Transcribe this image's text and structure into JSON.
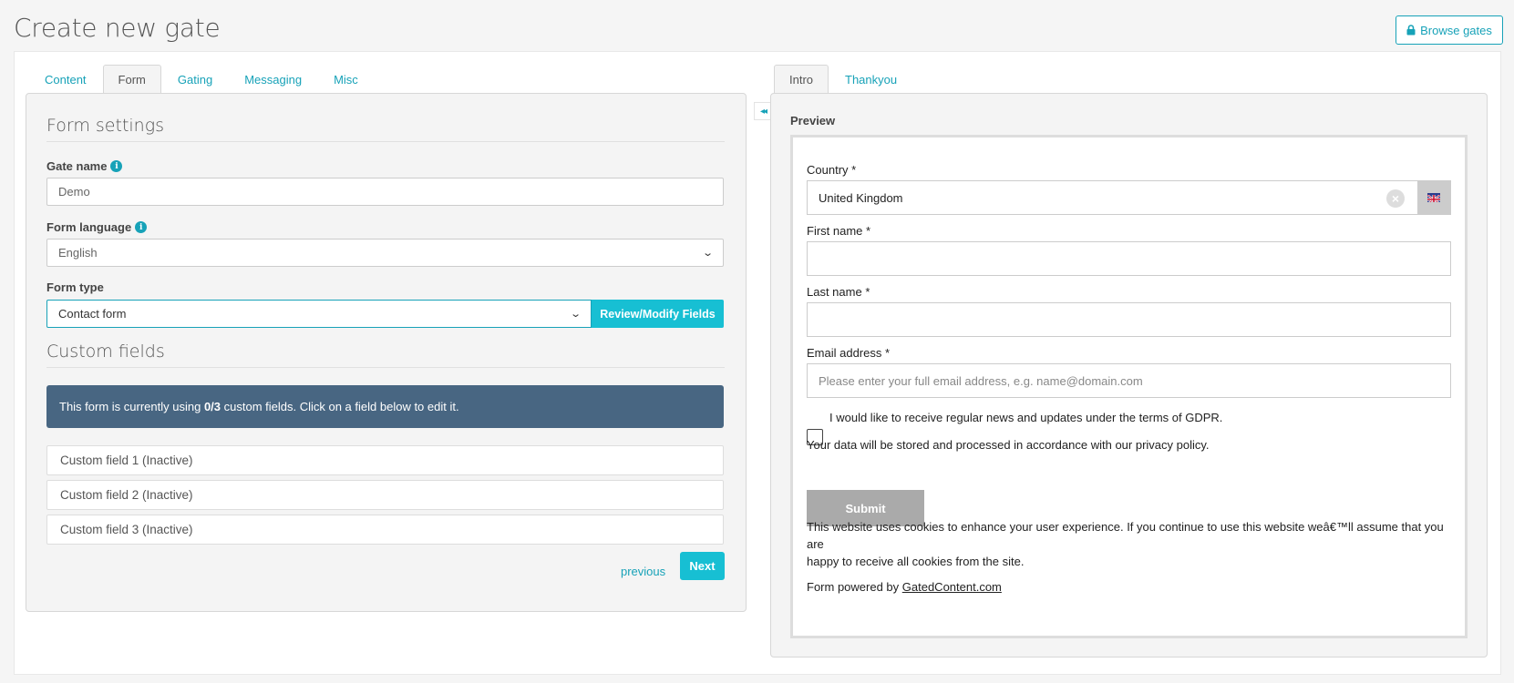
{
  "page": {
    "title": "Create new gate"
  },
  "header": {
    "browse_button": "Browse gates",
    "browse_icon": "lock-icon"
  },
  "left_tabs": [
    "Content",
    "Form",
    "Gating",
    "Messaging",
    "Misc"
  ],
  "left_active_tab": "Form",
  "right_tabs": [
    "Intro",
    "Thankyou"
  ],
  "right_active_tab": "Intro",
  "form_settings": {
    "title": "Form settings",
    "gate_name_label": "Gate name",
    "gate_name_value": "Demo",
    "form_language_label": "Form language",
    "form_language_value": "English",
    "form_type_label": "Form type",
    "form_type_value": "Contact form",
    "review_button": "Review/Modify Fields"
  },
  "custom_fields": {
    "title": "Custom fields",
    "banner_prefix": "This form is currently using ",
    "banner_count": "0/3",
    "banner_suffix": " custom fields. Click on a field below to edit it.",
    "items": [
      "Custom field 1 (Inactive)",
      "Custom field 2 (Inactive)",
      "Custom field 3 (Inactive)"
    ]
  },
  "nav": {
    "previous": "previous",
    "next": "Next"
  },
  "collapse_button": "◂◂",
  "preview": {
    "label": "Preview",
    "country_label": "Country *",
    "country_value": "United Kingdom",
    "first_name_label": "First name *",
    "last_name_label": "Last name *",
    "email_label": "Email address *",
    "email_placeholder": "Please enter your full email address, e.g. name@domain.com",
    "gdpr_text": "I would like to receive regular news and updates under the terms of GDPR.",
    "privacy_text": "Your data will be stored and processed in accordance with our privacy policy.",
    "submit": "Submit",
    "cookie_line1": "This website uses cookies to enhance your user experience. If you continue to use this website weâ€™ll assume that you are",
    "cookie_line2": "happy to receive all cookies from the site.",
    "powered_prefix": "Form powered by ",
    "powered_link": "GatedContent.com"
  },
  "colors": {
    "accent": "#17a2b8",
    "button": "#17bfd3",
    "banner": "#486682",
    "submit": "#aaaaaa"
  }
}
